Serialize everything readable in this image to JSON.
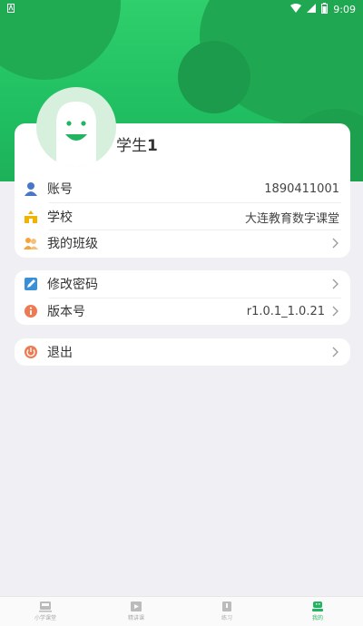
{
  "status": {
    "time": "9:09"
  },
  "profile": {
    "name_prefix": "学生",
    "name_suffix": "1"
  },
  "info_rows": [
    {
      "label": "账号",
      "value": "1890411001"
    },
    {
      "label": "学校",
      "value": "大连教育数字课堂"
    },
    {
      "label": "我的班级",
      "value": ""
    }
  ],
  "settings_rows": [
    {
      "label": "修改密码",
      "value": ""
    },
    {
      "label": "版本号",
      "value": "r1.0.1_1.0.21"
    }
  ],
  "logout": {
    "label": "退出"
  },
  "tabs": [
    {
      "label": "小学课堂"
    },
    {
      "label": "精讲课"
    },
    {
      "label": "练习"
    },
    {
      "label": "我的"
    }
  ],
  "colors": {
    "brand": "#21c163",
    "account_icon": "#4a76c9",
    "school_icon": "#f0b400",
    "class_icon": "#f5a33a",
    "password_icon": "#3a8fd9",
    "version_icon": "#ef7a52",
    "logout_icon": "#ef7a52"
  }
}
